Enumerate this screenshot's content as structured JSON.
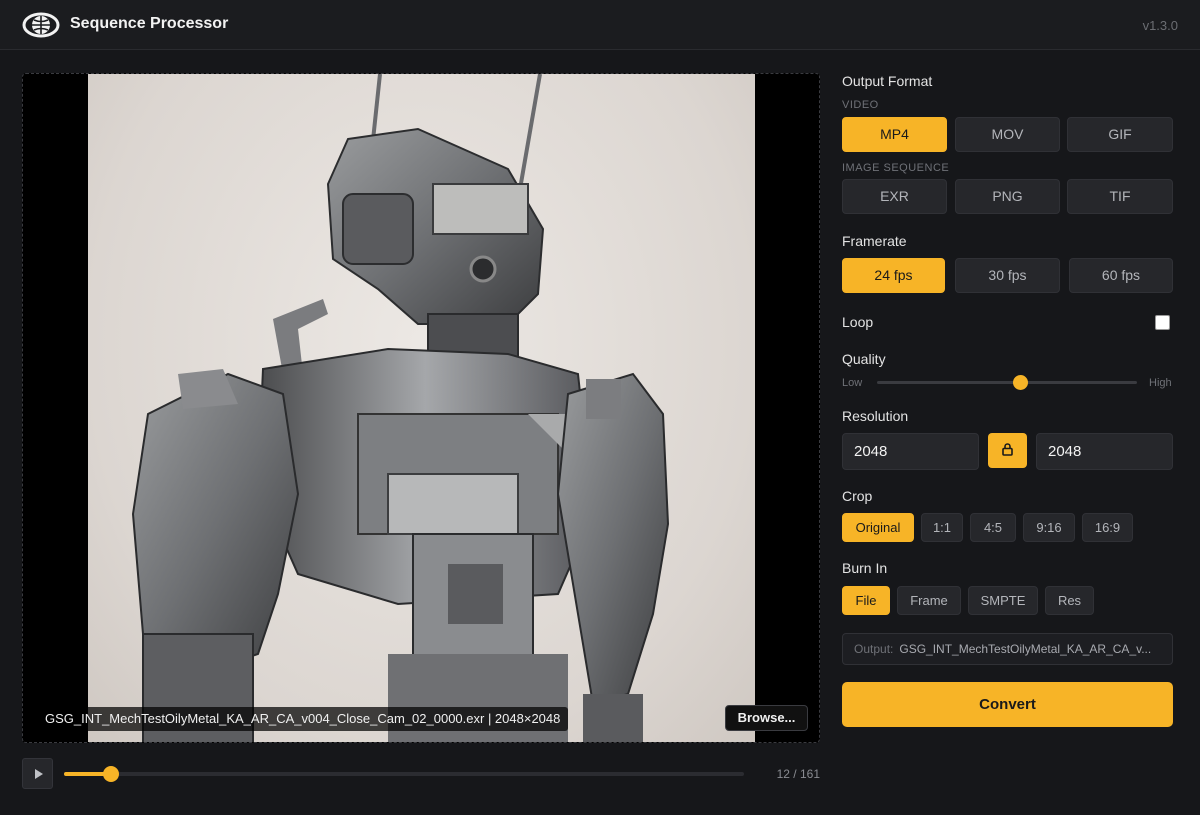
{
  "app": {
    "title": "Sequence Processor",
    "version": "v1.3.0"
  },
  "viewer": {
    "file_label": "GSG_INT_MechTestOilyMetal_KA_AR_CA_v004_Close_Cam_02_0000.exr | 2048×2048",
    "browse_label": "Browse...",
    "current_frame": 12,
    "total_frames": 161,
    "frame_counter": "12 / 161"
  },
  "output_format": {
    "label": "Output Format",
    "video_label": "VIDEO",
    "video_options": [
      "MP4",
      "MOV",
      "GIF"
    ],
    "image_sequence_label": "IMAGE SEQUENCE",
    "image_options": [
      "EXR",
      "PNG",
      "TIF"
    ],
    "selected": "MP4"
  },
  "framerate": {
    "label": "Framerate",
    "options": [
      "24 fps",
      "30 fps",
      "60 fps"
    ],
    "selected": "24 fps"
  },
  "loop": {
    "label": "Loop",
    "checked": false
  },
  "quality": {
    "label": "Quality",
    "low_label": "Low",
    "high_label": "High",
    "value": 0.55
  },
  "resolution": {
    "label": "Resolution",
    "width": "2048",
    "height": "2048",
    "locked": true
  },
  "crop": {
    "label": "Crop",
    "options": [
      "Original",
      "1:1",
      "4:5",
      "9:16",
      "16:9"
    ],
    "selected": "Original"
  },
  "burn_in": {
    "label": "Burn In",
    "options": [
      "File",
      "Frame",
      "SMPTE",
      "Res"
    ],
    "selected": [
      "File"
    ]
  },
  "output": {
    "prefix": "Output:",
    "value": "GSG_INT_MechTestOilyMetal_KA_AR_CA_v..."
  },
  "convert_label": "Convert",
  "colors": {
    "accent": "#f7b427",
    "background": "#16171a",
    "panel": "#26272b"
  }
}
